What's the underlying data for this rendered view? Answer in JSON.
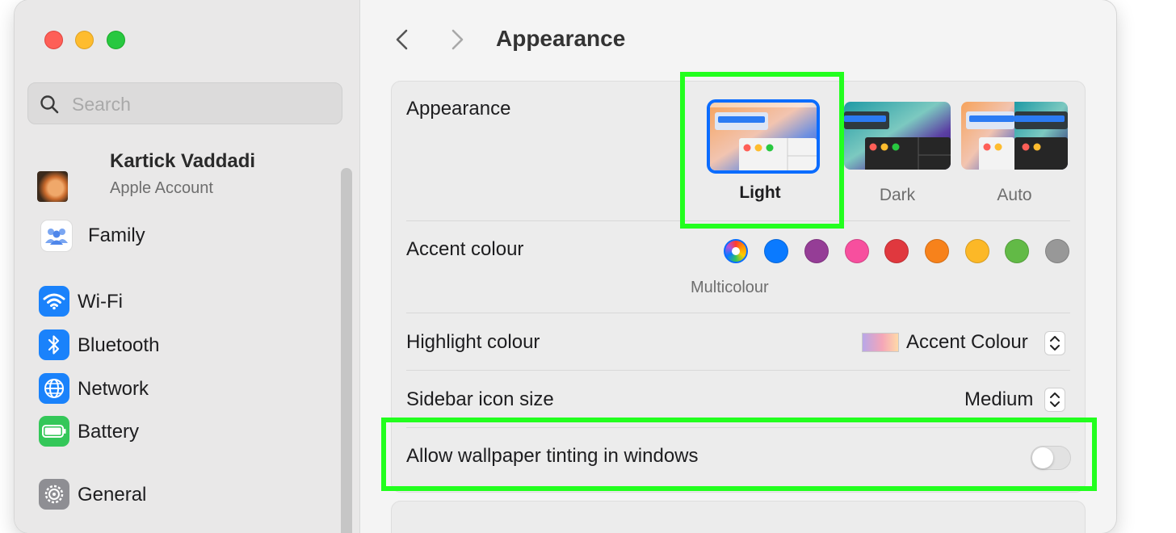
{
  "window": {
    "traffic_lights": [
      "close",
      "minimize",
      "zoom"
    ],
    "colors": {
      "close": "#fe5f57",
      "minimize": "#febc2e",
      "zoom": "#28c840"
    }
  },
  "sidebar": {
    "search": {
      "placeholder": "Search",
      "value": ""
    },
    "account": {
      "name": "Kartick Vaddadi",
      "subtitle": "Apple Account"
    },
    "items": [
      {
        "label": "Family",
        "icon": "family-icon"
      },
      {
        "label": "Wi-Fi",
        "icon": "wifi-icon"
      },
      {
        "label": "Bluetooth",
        "icon": "bluetooth-icon"
      },
      {
        "label": "Network",
        "icon": "network-globe-icon"
      },
      {
        "label": "Battery",
        "icon": "battery-icon"
      },
      {
        "label": "General",
        "icon": "gear-icon"
      }
    ]
  },
  "header": {
    "title": "Appearance"
  },
  "appearance": {
    "label": "Appearance",
    "options": [
      {
        "label": "Light",
        "selected": true
      },
      {
        "label": "Dark",
        "selected": false
      },
      {
        "label": "Auto",
        "selected": false
      }
    ]
  },
  "accent": {
    "label": "Accent colour",
    "selected_caption": "Multicolour",
    "swatches": [
      {
        "name": "multicolour",
        "color": "conic"
      },
      {
        "name": "blue",
        "color": "#0a7aff"
      },
      {
        "name": "purple",
        "color": "#953d96"
      },
      {
        "name": "pink",
        "color": "#f74f9e"
      },
      {
        "name": "red",
        "color": "#e0383e"
      },
      {
        "name": "orange",
        "color": "#f7821b"
      },
      {
        "name": "yellow",
        "color": "#fcb827"
      },
      {
        "name": "green",
        "color": "#62ba46"
      },
      {
        "name": "graphite",
        "color": "#989898"
      }
    ]
  },
  "highlight": {
    "label": "Highlight colour",
    "value": "Accent Colour"
  },
  "sidebar_icon_size": {
    "label": "Sidebar icon size",
    "value": "Medium"
  },
  "wallpaper_tinting": {
    "label": "Allow wallpaper tinting in windows",
    "enabled": false
  },
  "annotation": {
    "color": "#22ff1e"
  }
}
